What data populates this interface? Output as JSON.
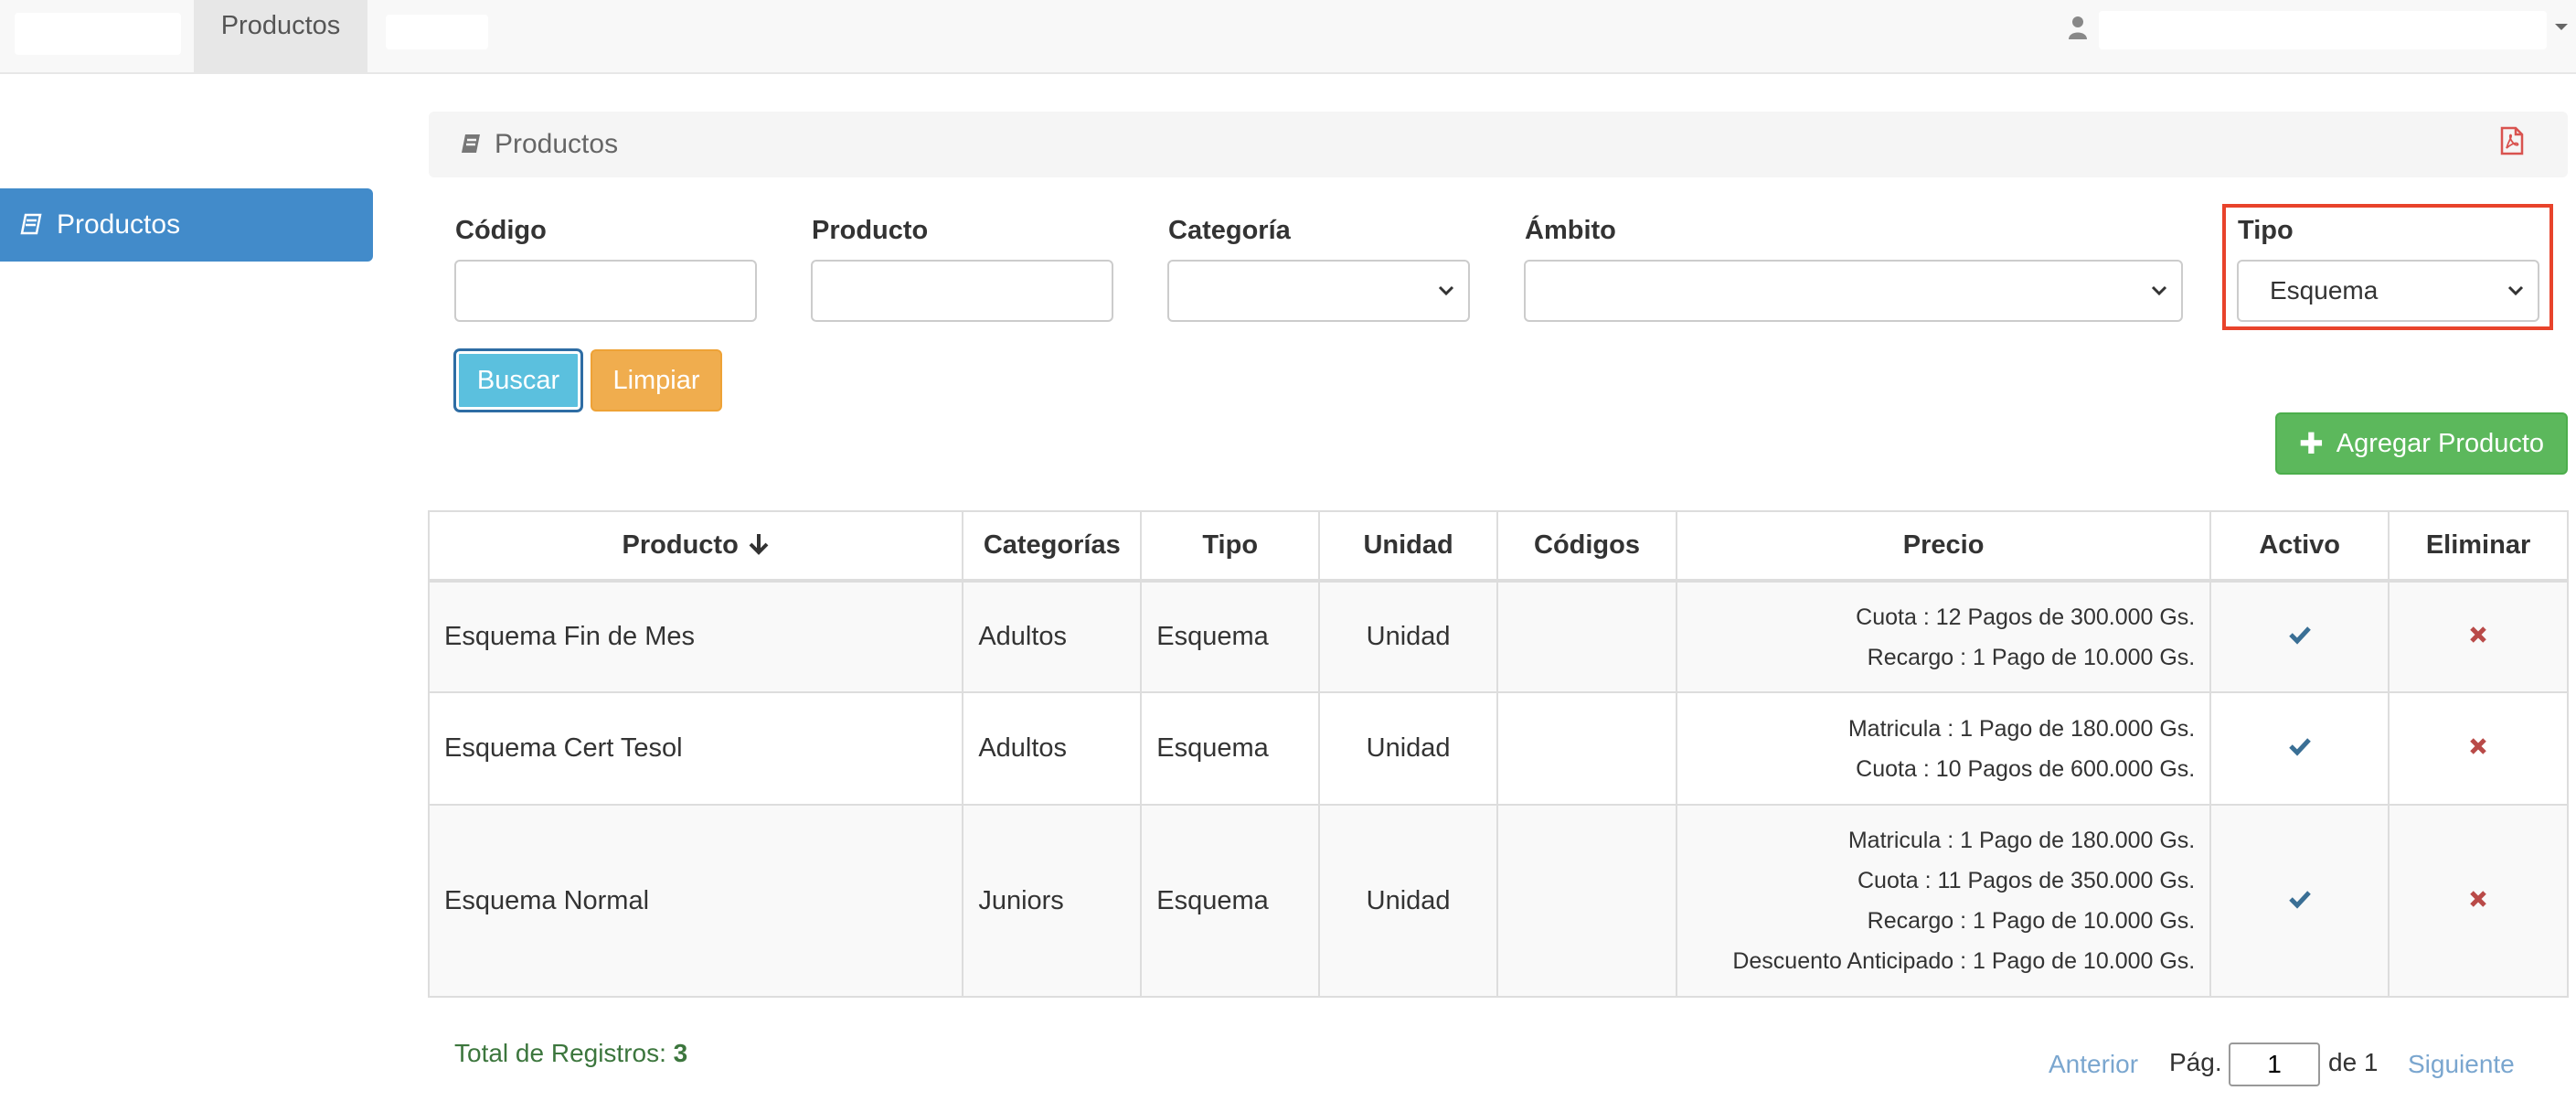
{
  "navbar": {
    "active_tab": "Productos"
  },
  "sidebar": {
    "items": [
      {
        "label": "Productos",
        "icon": "book-icon"
      }
    ]
  },
  "panel": {
    "title": "Productos",
    "export_icon": "pdf-icon"
  },
  "filters": {
    "codigo_label": "Código",
    "codigo_value": "",
    "producto_label": "Producto",
    "producto_value": "",
    "categoria_label": "Categoría",
    "categoria_value": "",
    "ambito_label": "Ámbito",
    "ambito_value": "",
    "tipo_label": "Tipo",
    "tipo_value": "Esquema"
  },
  "buttons": {
    "buscar": "Buscar",
    "limpiar": "Limpiar",
    "agregar": "Agregar Producto"
  },
  "table": {
    "headers": {
      "producto": "Producto",
      "categorias": "Categorías",
      "tipo": "Tipo",
      "unidad": "Unidad",
      "codigos": "Códigos",
      "precio": "Precio",
      "activo": "Activo",
      "eliminar": "Eliminar"
    },
    "rows": [
      {
        "producto": "Esquema Fin de Mes",
        "categorias": "Adultos",
        "tipo": "Esquema",
        "unidad": "Unidad",
        "codigos": "",
        "precio": [
          "Cuota : 12 Pagos de 300.000 Gs.",
          "Recargo : 1 Pago de 10.000 Gs."
        ],
        "activo": true
      },
      {
        "producto": "Esquema Cert Tesol",
        "categorias": "Adultos",
        "tipo": "Esquema",
        "unidad": "Unidad",
        "codigos": "",
        "precio": [
          "Matricula : 1 Pago de 180.000 Gs.",
          "Cuota : 10 Pagos de 600.000 Gs."
        ],
        "activo": true
      },
      {
        "producto": "Esquema Normal",
        "categorias": "Juniors",
        "tipo": "Esquema",
        "unidad": "Unidad",
        "codigos": "",
        "precio": [
          "Matricula : 1 Pago de 180.000 Gs.",
          "Cuota : 11 Pagos de 350.000 Gs.",
          "Recargo : 1 Pago de 10.000 Gs.",
          "Descuento Anticipado : 1 Pago de 10.000 Gs."
        ],
        "activo": true
      }
    ]
  },
  "footer": {
    "total_label": "Total de Registros:",
    "total_value": "3",
    "prev": "Anterior",
    "page_label": "Pág.",
    "page_value": "1",
    "of_label": "de 1",
    "next": "Siguiente"
  },
  "colors": {
    "primary": "#428bca",
    "success": "#5cb85c",
    "warning": "#f0ad4e",
    "info": "#5bc0de",
    "highlight": "#e8432b",
    "check": "#3a6f95",
    "delete": "#b94a48"
  }
}
